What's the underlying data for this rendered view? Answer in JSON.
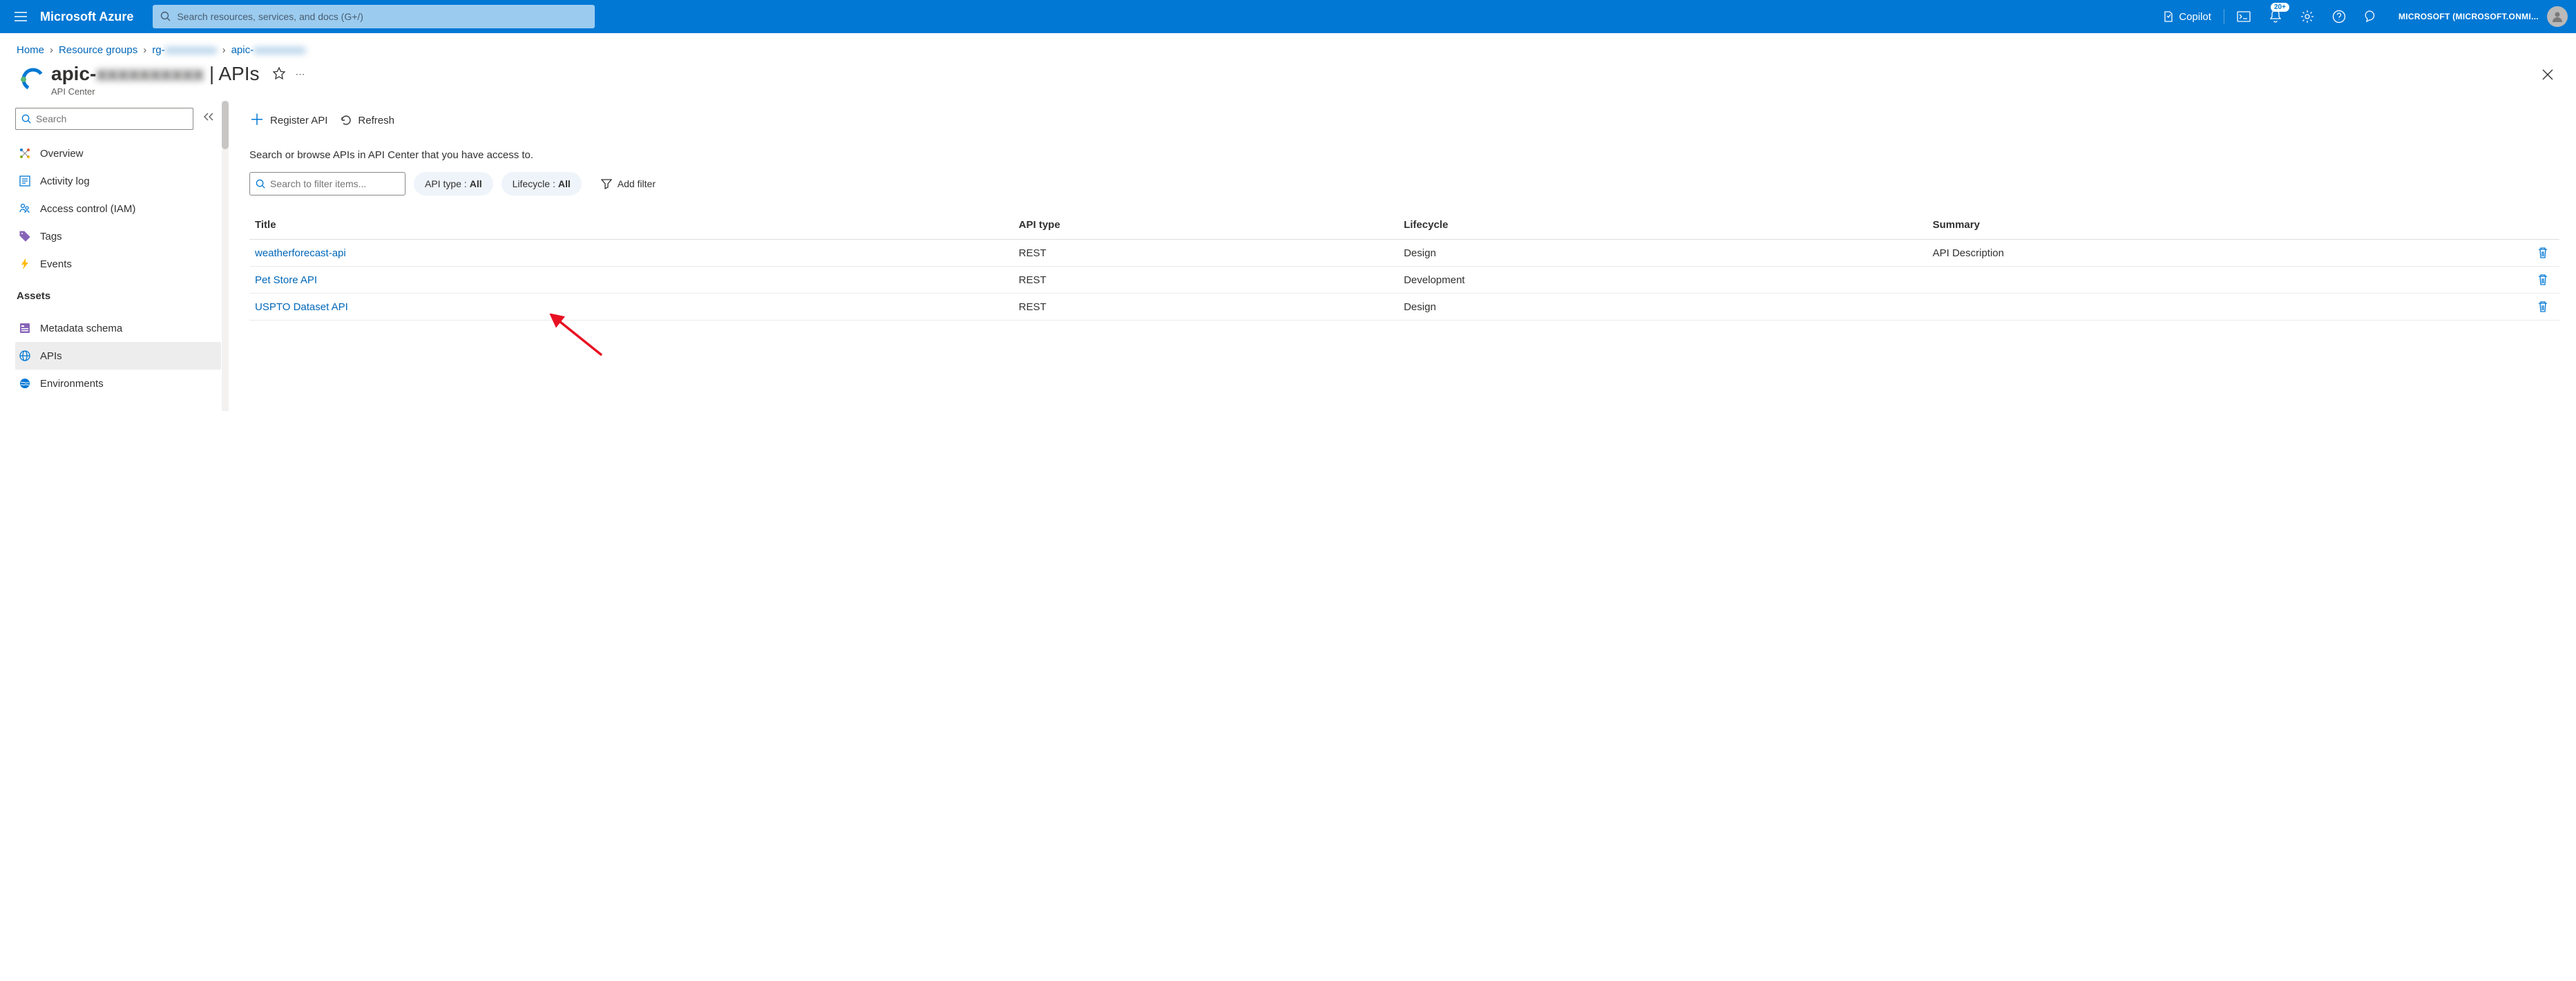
{
  "topbar": {
    "brand": "Microsoft Azure",
    "search_placeholder": "Search resources, services, and docs (G+/)",
    "copilot": "Copilot",
    "badge": "20+",
    "account": "MICROSOFT (MICROSOFT.ONMI..."
  },
  "breadcrumb": {
    "items": [
      "Home",
      "Resource groups",
      "rg-xxxxxxxxxx",
      "apic-xxxxxxxxxx"
    ]
  },
  "header": {
    "title_prefix": "apic-",
    "title_blurred": "xxxxxxxxxx",
    "title_suffix": " | APIs",
    "subtitle": "API Center"
  },
  "sidebar": {
    "search_placeholder": "Search",
    "items": [
      {
        "icon": "overview",
        "label": "Overview"
      },
      {
        "icon": "activity",
        "label": "Activity log"
      },
      {
        "icon": "iam",
        "label": "Access control (IAM)"
      },
      {
        "icon": "tags",
        "label": "Tags"
      },
      {
        "icon": "events",
        "label": "Events"
      }
    ],
    "section": "Assets",
    "assets": [
      {
        "icon": "metadata",
        "label": "Metadata schema"
      },
      {
        "icon": "apis",
        "label": "APIs",
        "selected": true
      },
      {
        "icon": "env",
        "label": "Environments"
      }
    ]
  },
  "toolbar": {
    "register": "Register API",
    "refresh": "Refresh"
  },
  "description": "Search or browse APIs in API Center that you have access to.",
  "filters": {
    "search_placeholder": "Search to filter items...",
    "pills": [
      {
        "label": "API type : ",
        "value": "All"
      },
      {
        "label": "Lifecycle : ",
        "value": "All"
      }
    ],
    "add": "Add filter"
  },
  "table": {
    "headers": [
      "Title",
      "API type",
      "Lifecycle",
      "Summary"
    ],
    "rows": [
      {
        "title": "weatherforecast-api",
        "api_type": "REST",
        "lifecycle": "Design",
        "summary": "API Description"
      },
      {
        "title": "Pet Store API",
        "api_type": "REST",
        "lifecycle": "Development",
        "summary": ""
      },
      {
        "title": "USPTO Dataset API",
        "api_type": "REST",
        "lifecycle": "Design",
        "summary": ""
      }
    ]
  },
  "colors": {
    "azure_blue": "#0078d4",
    "link_blue": "#0067b8"
  }
}
